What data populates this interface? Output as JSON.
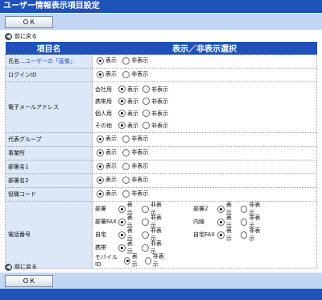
{
  "header": {
    "title": "ユーザー情報表示項目設定"
  },
  "buttons": {
    "ok_label": "ＯＫ"
  },
  "back": {
    "label": "前に戻る"
  },
  "columns": {
    "item": "項目名",
    "visibility": "表示／非表示選択"
  },
  "options": {
    "show": "表示",
    "hide": "非表示"
  },
  "rows": {
    "name": {
      "label": "氏名…",
      "suffix": "ユーザーの「画像」",
      "selected": "show"
    },
    "login": {
      "label": "ログインID",
      "selected": "show"
    },
    "email": {
      "label": "電子メールアドレス",
      "items": [
        {
          "label": "会社用",
          "selected": "show"
        },
        {
          "label": "携帯用",
          "selected": "show"
        },
        {
          "label": "個人用",
          "selected": "show"
        },
        {
          "label": "その他",
          "selected": "show"
        }
      ]
    },
    "group": {
      "label": "代表グループ",
      "selected": "show"
    },
    "office": {
      "label": "事業所",
      "selected": "show"
    },
    "dept1": {
      "label": "部署名1",
      "selected": "show"
    },
    "dept2": {
      "label": "部署名2",
      "selected": "show"
    },
    "role": {
      "label": "役職コード",
      "selected": "show"
    },
    "phone": {
      "label": "電話番号",
      "items": [
        {
          "label": "部署",
          "selected": "show"
        },
        {
          "label": "部署2",
          "selected": "show"
        },
        {
          "label": "部署FAX",
          "selected": "show"
        },
        {
          "label": "内線",
          "selected": "show"
        },
        {
          "label": "自宅",
          "selected": "show"
        },
        {
          "label": "自宅FAX",
          "selected": "show"
        },
        {
          "label": "携帯",
          "selected": "show"
        },
        {
          "label": "モバイルID",
          "selected": "show"
        }
      ]
    }
  }
}
